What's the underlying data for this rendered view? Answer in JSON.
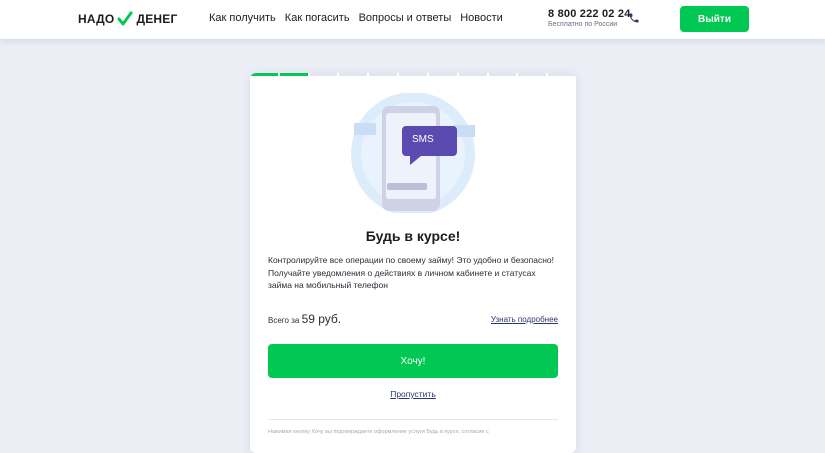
{
  "header": {
    "logo_left": "НАДО",
    "logo_right": "ДЕНЕГ",
    "nav": [
      "Как получить",
      "Как погасить",
      "Вопросы и ответы",
      "Новости"
    ],
    "phone": "8 800 222 02 24",
    "phone_sub": "Бесплатно по России",
    "logout_label": "Выйти"
  },
  "progress": {
    "done": 2,
    "total": 11
  },
  "card": {
    "sms_label": "SMS",
    "title": "Будь в курсе!",
    "desc_line1": "Контролируйте все операции по своему займу! Это удобно и безопасно!",
    "desc_line2": "Получайте уведомления о действиях в личном кабинете и статусах займа на мобильный телефон",
    "price_prefix": "Всего за",
    "price_amount": "59 руб.",
    "more_link": "Узнать подробнее",
    "want_button": "Хочу!",
    "skip_link": "Пропустить",
    "fine_print": "Нажимая кнопку Хочу вы подтверждаете оформление услуги Будь в курсе, согласие с"
  },
  "colors": {
    "accent": "#00c853",
    "sms_bubble": "#5b4bb0",
    "link": "#2e3570"
  }
}
